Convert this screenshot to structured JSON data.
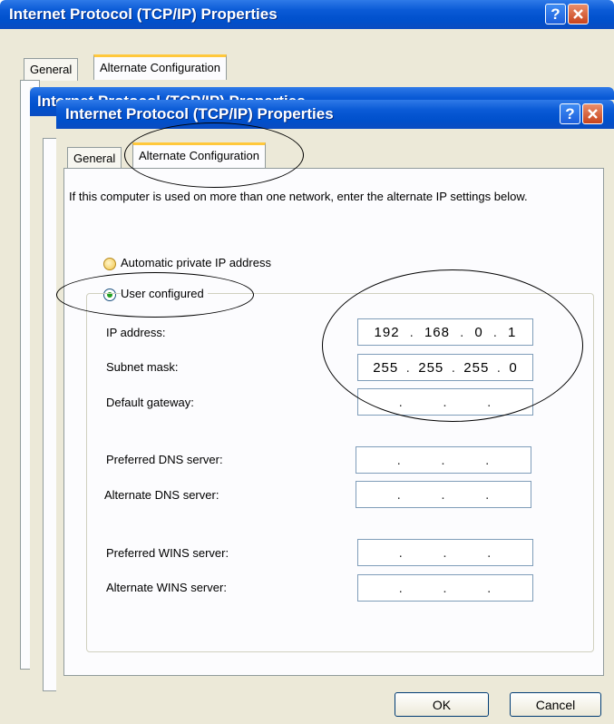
{
  "back_dialog": {
    "title": "Internet Protocol (TCP/IP) Properties",
    "tabs": [
      "General",
      "Alternate Configuration"
    ]
  },
  "middle_dialog": {
    "title": "Internet Protocol (TCP/IP) Properties"
  },
  "dialog": {
    "title": "Internet Protocol (TCP/IP) Properties",
    "help_glyph": "?",
    "tabs": {
      "general": "General",
      "alternate": "Alternate Configuration"
    },
    "intro": "If this computer is used on more than one network, enter the alternate IP settings below.",
    "options": {
      "automatic": "Automatic private IP address",
      "user": "User configured",
      "selected": "user"
    },
    "fields": {
      "ip": {
        "label": "IP address:",
        "octets": [
          "192",
          "168",
          "0",
          "1"
        ]
      },
      "subnet": {
        "label": "Subnet mask:",
        "octets": [
          "255",
          "255",
          "255",
          "0"
        ]
      },
      "gateway": {
        "label": "Default gateway:",
        "octets": [
          "",
          "",
          "",
          ""
        ]
      },
      "dns1": {
        "label": "Preferred DNS server:",
        "octets": [
          "",
          "",
          "",
          ""
        ]
      },
      "dns2": {
        "label": "Alternate DNS server:",
        "octets": [
          "",
          "",
          "",
          ""
        ]
      },
      "wins1": {
        "label": "Preferred WINS server:",
        "octets": [
          "",
          "",
          "",
          ""
        ]
      },
      "wins2": {
        "label": "Alternate WINS server:",
        "octets": [
          "",
          "",
          "",
          ""
        ]
      }
    },
    "buttons": {
      "ok": "OK",
      "cancel": "Cancel"
    }
  },
  "colors": {
    "titlebar": "#0a5ad6",
    "dialog_bg": "#ece9d8",
    "tab_highlight": "#ffc83c",
    "radio_selected": "#21a121"
  }
}
